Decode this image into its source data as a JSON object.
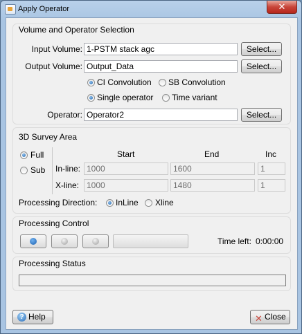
{
  "window": {
    "title": "Apply Operator",
    "close_glyph": "✕"
  },
  "volume_section": {
    "title": "Volume and Operator Selection",
    "input_volume_label": "Input Volume:",
    "input_volume_value": "1-PSTM stack agc",
    "output_volume_label": "Output Volume:",
    "output_volume_value": "Output_Data",
    "select_label": "Select...",
    "convolution_options": [
      "CI Convolution",
      "SB Convolution"
    ],
    "convolution_selected": "CI Convolution",
    "operator_mode_options": [
      "Single operator",
      "Time variant"
    ],
    "operator_mode_selected": "Single operator",
    "operator_label": "Operator:",
    "operator_value": "Operator2"
  },
  "survey_section": {
    "title": "3D Survey Area",
    "area_options": [
      "Full",
      "Sub"
    ],
    "area_selected": "Full",
    "col_start": "Start",
    "col_end": "End",
    "col_inc": "Inc",
    "inline_label": "In-line:",
    "inline_start": "1000",
    "inline_end": "1600",
    "inline_inc": "1",
    "xline_label": "X-line:",
    "xline_start": "1000",
    "xline_end": "1480",
    "xline_inc": "1",
    "direction_label": "Processing Direction:",
    "direction_options": [
      "InLine",
      "Xline"
    ],
    "direction_selected": "InLine"
  },
  "processing_control": {
    "title": "Processing Control",
    "buttons": [
      "play-icon",
      "pause-icon",
      "stop-icon"
    ],
    "time_left_label": "Time left:",
    "time_left_value": "0:00:00",
    "progress_fraction": 0
  },
  "processing_status": {
    "title": "Processing Status",
    "status_text": ""
  },
  "footer": {
    "help_label": "Help",
    "close_label": "Close"
  },
  "colors": {
    "accent_blue": "#2a6cb8",
    "close_red": "#c8453a"
  }
}
